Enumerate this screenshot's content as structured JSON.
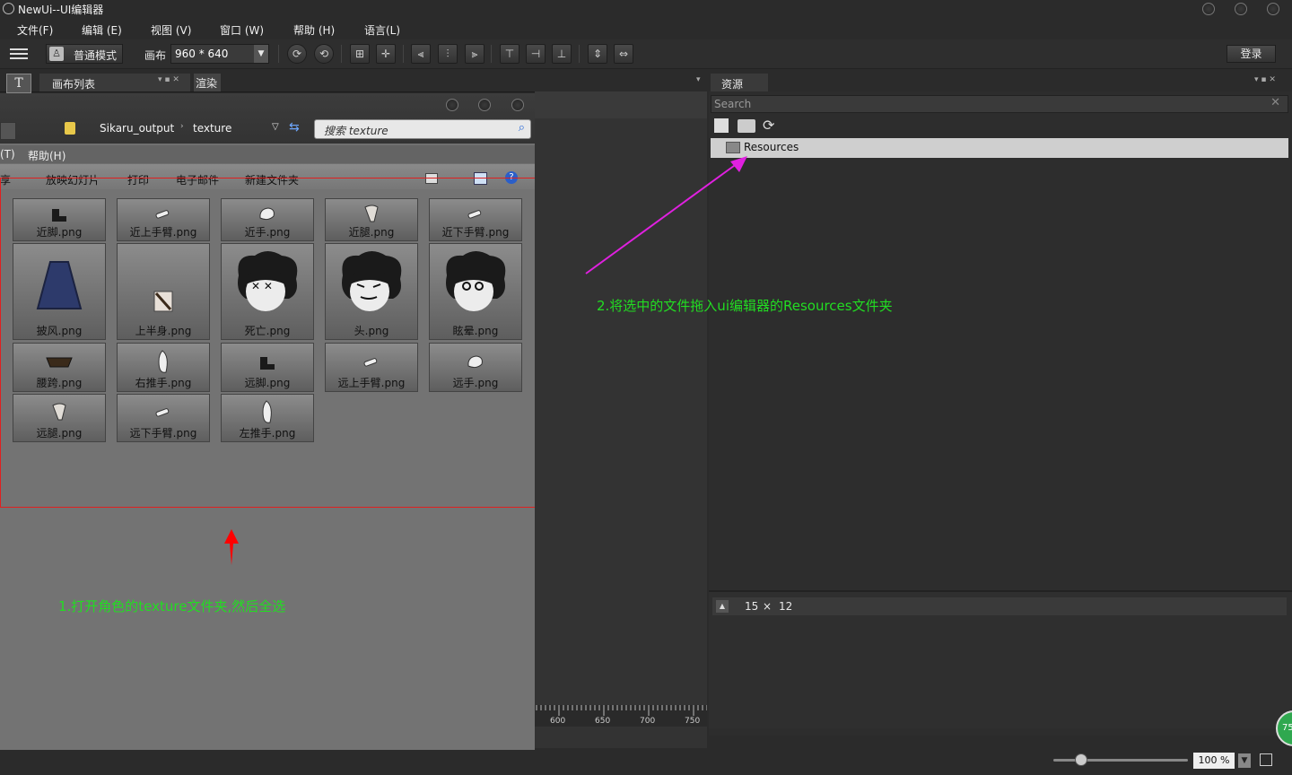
{
  "window": {
    "title": "NewUi--UI编辑器"
  },
  "menu": {
    "items": [
      "文件(F)",
      "编辑 (E)",
      "视图 (V)",
      "窗口 (W)",
      "帮助 (H)",
      "语言(L)"
    ]
  },
  "toolbar": {
    "mode_label": "普通模式",
    "canvas_label": "画布",
    "canvas_size": "960 * 640",
    "login": "登录"
  },
  "left_tabs": {
    "canvas_list": "画布列表",
    "render": "渲染"
  },
  "explorer": {
    "breadcrumb": [
      "Sikaru_output",
      "texture"
    ],
    "search_placeholder": "搜索 texture",
    "menu_partial": "(T)",
    "menu_help": "帮助(H)",
    "commands": [
      "享",
      "放映幻灯片",
      "打印",
      "电子邮件",
      "新建文件夹"
    ],
    "files": [
      {
        "name": "近脚.png",
        "icon": "foot"
      },
      {
        "name": "近上手臂.png",
        "icon": "arm"
      },
      {
        "name": "近手.png",
        "icon": "hand"
      },
      {
        "name": "近腿.png",
        "icon": "leg"
      },
      {
        "name": "近下手臂.png",
        "icon": "arm"
      },
      {
        "name": "披风.png",
        "icon": "cape"
      },
      {
        "name": "上半身.png",
        "icon": "torso"
      },
      {
        "name": "死亡.png",
        "icon": "head-dead"
      },
      {
        "name": "头.png",
        "icon": "head"
      },
      {
        "name": "眩晕.png",
        "icon": "head-dizzy"
      },
      {
        "name": "腰跨.png",
        "icon": "waist"
      },
      {
        "name": "右推手.png",
        "icon": "palm"
      },
      {
        "name": "远脚.png",
        "icon": "foot"
      },
      {
        "name": "远上手臂.png",
        "icon": "arm"
      },
      {
        "name": "远手.png",
        "icon": "hand"
      },
      {
        "name": "远腿.png",
        "icon": "leg"
      },
      {
        "name": "远下手臂.png",
        "icon": "arm"
      },
      {
        "name": "左推手.png",
        "icon": "palm"
      }
    ]
  },
  "annotations": {
    "step1": "1.打开角色的texture文件夹,然后全选",
    "step2": "2.将选中的文件拖入ui编辑器的Resources文件夹"
  },
  "resources": {
    "tab": "资源",
    "search_placeholder": "Search",
    "folder": "Resources"
  },
  "bottom_right": {
    "width": "15",
    "x": "×",
    "height": "12"
  },
  "ruler": {
    "ticks": [
      "600",
      "650",
      "700",
      "750"
    ]
  },
  "status": {
    "zoom": "100 %",
    "badge": "75"
  },
  "colors": {
    "annotation_green": "#22dd22",
    "arrow_red": "#ff0000",
    "arrow_magenta": "#e020e0",
    "highlight_box": "#e02020"
  }
}
